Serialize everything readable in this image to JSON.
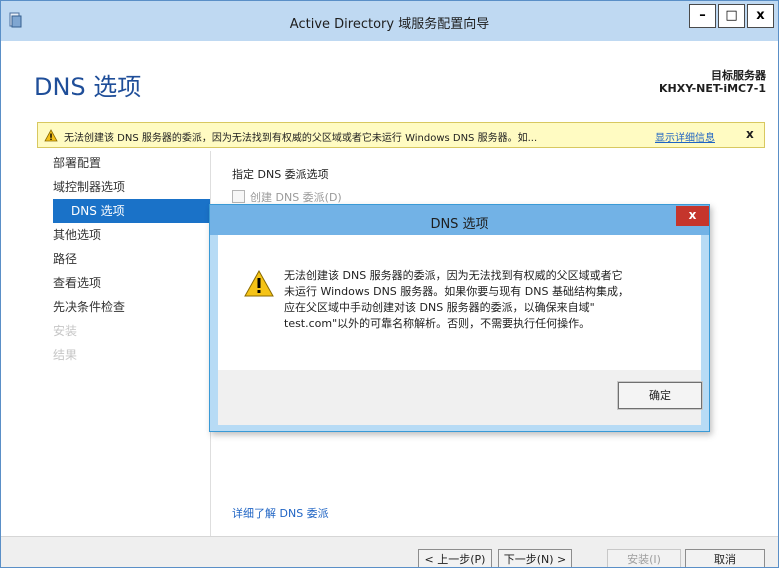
{
  "window": {
    "title": "Active Directory 域服务配置向导",
    "controls": {
      "minimize": "–",
      "maximize": "□",
      "close": "x"
    }
  },
  "header": {
    "page_title": "DNS 选项",
    "target_label": "目标服务器",
    "target_value": "KHXY-NET-iMC7-1"
  },
  "warning_bar": {
    "icon": "warning-triangle-icon",
    "text": "无法创建该 DNS 服务器的委派，因为无法找到有权威的父区域或者它未运行 Windows DNS 服务器。如...",
    "link": "显示详细信息",
    "close": "x"
  },
  "nav": {
    "items": [
      {
        "label": "部署配置",
        "state": "normal"
      },
      {
        "label": "域控制器选项",
        "state": "normal"
      },
      {
        "label": "DNS 选项",
        "state": "active"
      },
      {
        "label": "其他选项",
        "state": "normal"
      },
      {
        "label": "路径",
        "state": "normal"
      },
      {
        "label": "查看选项",
        "state": "normal"
      },
      {
        "label": "先决条件检查",
        "state": "normal"
      },
      {
        "label": "安装",
        "state": "disabled"
      },
      {
        "label": "结果",
        "state": "disabled"
      }
    ]
  },
  "main": {
    "section_label": "指定 DNS 委派选项",
    "checkbox_label": "创建 DNS 委派(D)",
    "checkbox_checked": false,
    "learn_more": "详细了解 DNS 委派"
  },
  "footer": {
    "prev": "< 上一步(P)",
    "next": "下一步(N) >",
    "install": "安装(I)",
    "cancel": "取消"
  },
  "dialog": {
    "title": "DNS 选项",
    "close": "x",
    "icon": "warning-triangle-icon",
    "message_lines": [
      "无法创建该 DNS 服务器的委派，因为无法找到有权威的父区域或者它",
      "未运行 Windows DNS 服务器。如果你要与现有 DNS 基础结构集成，",
      "应在父区域中手动创建对该 DNS 服务器的委派，以确保来自域\"",
      "test.com\"以外的可靠名称解析。否则，不需要执行任何操作。"
    ],
    "ok": "确定"
  },
  "colors": {
    "titlebar": "#bfd9f2",
    "accent_blue": "#1a72c8",
    "dialog_title": "#72b2e6",
    "dialog_close": "#c5352c",
    "warning_bg": "#fffbc2"
  }
}
